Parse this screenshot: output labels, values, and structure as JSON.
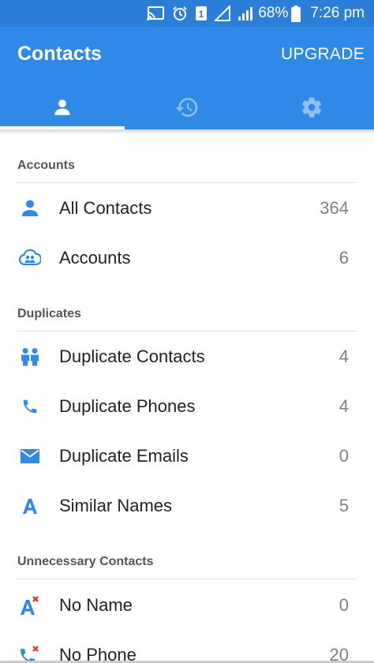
{
  "status_bar": {
    "battery_percent": "68%",
    "time": "7:26 pm",
    "sim_number": "1"
  },
  "app_bar": {
    "title": "Contacts",
    "upgrade_label": "UPGRADE",
    "tabs": [
      {
        "icon": "person-icon",
        "active": true
      },
      {
        "icon": "history-icon",
        "active": false
      },
      {
        "icon": "gear-icon",
        "active": false
      }
    ]
  },
  "sections": {
    "accounts": {
      "header": "Accounts",
      "items": [
        {
          "label": "All Contacts",
          "count": "364",
          "icon": "person-icon"
        },
        {
          "label": "Accounts",
          "count": "6",
          "icon": "cloud-people-icon"
        }
      ]
    },
    "duplicates": {
      "header": "Duplicates",
      "items": [
        {
          "label": "Duplicate Contacts",
          "count": "4",
          "icon": "people-icon"
        },
        {
          "label": "Duplicate Phones",
          "count": "4",
          "icon": "phone-icon"
        },
        {
          "label": "Duplicate Emails",
          "count": "0",
          "icon": "email-icon"
        },
        {
          "label": "Similar Names",
          "count": "5",
          "icon": "letter-a-icon"
        }
      ]
    },
    "unnecessary": {
      "header": "Unnecessary Contacts",
      "items": [
        {
          "label": "No Name",
          "count": "0",
          "icon": "letter-a-x-icon"
        },
        {
          "label": "No Phone",
          "count": "20",
          "icon": "phone-x-icon"
        }
      ]
    }
  },
  "colors": {
    "status_bar": "#2a7ed7",
    "app_bar": "#2e8ae6",
    "icon_blue": "#2e8ae6",
    "alert_red": "#e53935"
  }
}
